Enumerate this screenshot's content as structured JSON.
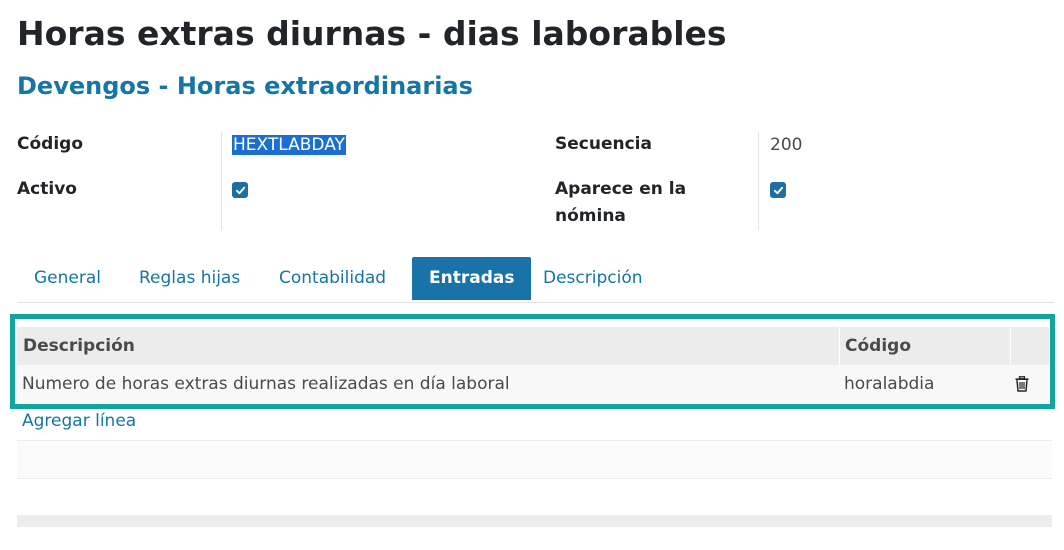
{
  "header": {
    "title": "Horas extras diurnas - dias laborables",
    "subtitle": "Devengos - Horas extraordinarias"
  },
  "fields": {
    "codigo_label": "Código",
    "codigo_value": "HEXTLABDAY",
    "activo_label": "Activo",
    "activo_checked": true,
    "secuencia_label": "Secuencia",
    "secuencia_value": "200",
    "aparece_label_1": "Aparece en la",
    "aparece_label_2": "nómina",
    "aparece_checked": true
  },
  "tabs": [
    {
      "label": "General",
      "active": false
    },
    {
      "label": "Reglas hijas",
      "active": false
    },
    {
      "label": "Contabilidad",
      "active": false
    },
    {
      "label": "Entradas",
      "active": true
    },
    {
      "label": "Descripción",
      "active": false
    }
  ],
  "table": {
    "columns": [
      "Descripción",
      "Código"
    ],
    "rows": [
      {
        "descripcion": "Numero de horas extras diurnas realizadas en día laboral",
        "codigo": "horalabdia"
      }
    ],
    "add_line": "Agregar línea"
  },
  "colors": {
    "accent": "#1475a6",
    "active_tab": "#1a73a8",
    "highlight": "#11a59c",
    "checkbox": "#1f6ea3"
  }
}
